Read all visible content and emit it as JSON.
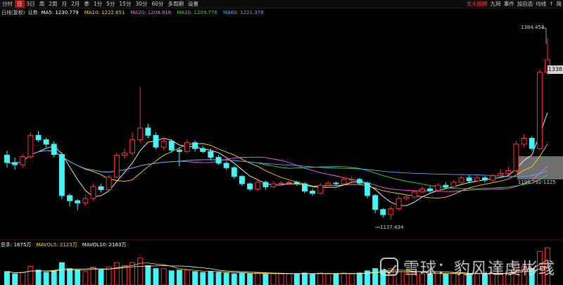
{
  "toolbar": {
    "tabs": [
      "分时",
      "日",
      "3日",
      "周",
      "2周",
      "月",
      "2月",
      "季",
      "1分",
      "5分",
      "15分",
      "30分",
      "60分",
      "多周期",
      "设置"
    ],
    "active_tab": "日",
    "tools": [
      "龙头回顾",
      "九转",
      "事件",
      "加自选",
      "均线",
      "↑",
      "简"
    ]
  },
  "ma_legend": {
    "title": "日线(复权)",
    "sub": "证券",
    "items": [
      {
        "label": "MA5: 1230.779",
        "color": "#ffffff"
      },
      {
        "label": "MA10: 1222.651",
        "color": "#ffd700"
      },
      {
        "label": "MA20: 1209.916",
        "color": "#ff60ff"
      },
      {
        "label": "MA30: 1209.776",
        "color": "#33e033"
      },
      {
        "label": "MA60: 1221.378",
        "color": "#55aaff"
      }
    ]
  },
  "vol_legend": [
    {
      "label": "总手: 1675万",
      "color": "#ffffff"
    },
    {
      "label": "MAVOL5: 2123万",
      "color": "#ffd700"
    },
    {
      "label": "MAVOL10: 2163万",
      "color": "#ffffff"
    }
  ],
  "price_labels": {
    "high": "1384.458",
    "low": "1137.434",
    "range": "1198.792-1225",
    "right_axis": "1338"
  },
  "watermark": "雪球：豹风達虔彬彧",
  "colors": {
    "up": "#ff3030",
    "down": "#3ff7f7",
    "ma5": "#ffffff",
    "ma10": "#ffd700",
    "ma20": "#ff60ff",
    "ma30": "#33e033",
    "ma60": "#55aaff"
  },
  "chart_data": {
    "type": "candlestick",
    "axis": {
      "price_ymin": 1120,
      "price_ymax": 1400
    },
    "candles": [
      [
        1225,
        1215,
        1231,
        1208
      ],
      [
        1215,
        1212,
        1222,
        1205
      ],
      [
        1212,
        1223,
        1226,
        1208
      ],
      [
        1223,
        1252,
        1256,
        1220
      ],
      [
        1252,
        1246,
        1258,
        1243
      ],
      [
        1246,
        1240,
        1249,
        1236
      ],
      [
        1240,
        1226,
        1244,
        1222
      ],
      [
        1226,
        1170,
        1229,
        1165
      ],
      [
        1170,
        1163,
        1173,
        1155
      ],
      [
        1163,
        1160,
        1165,
        1150
      ],
      [
        1160,
        1166,
        1170,
        1156
      ],
      [
        1166,
        1182,
        1186,
        1163
      ],
      [
        1182,
        1178,
        1186,
        1174
      ],
      [
        1178,
        1195,
        1198,
        1175
      ],
      [
        1195,
        1225,
        1228,
        1194
      ],
      [
        1225,
        1228,
        1234,
        1220
      ],
      [
        1228,
        1246,
        1256,
        1224
      ],
      [
        1246,
        1262,
        1318,
        1242
      ],
      [
        1262,
        1252,
        1268,
        1248
      ],
      [
        1252,
        1236,
        1256,
        1233
      ],
      [
        1236,
        1244,
        1249,
        1232
      ],
      [
        1244,
        1232,
        1247,
        1228
      ],
      [
        1232,
        1230,
        1236,
        1210
      ],
      [
        1230,
        1242,
        1246,
        1228
      ],
      [
        1242,
        1234,
        1245,
        1230
      ],
      [
        1234,
        1230,
        1238,
        1228
      ],
      [
        1230,
        1222,
        1234,
        1218
      ],
      [
        1222,
        1214,
        1225,
        1212
      ],
      [
        1214,
        1208,
        1216,
        1205
      ],
      [
        1208,
        1196,
        1210,
        1193
      ],
      [
        1196,
        1186,
        1198,
        1183
      ],
      [
        1186,
        1179,
        1188,
        1176
      ],
      [
        1179,
        1188,
        1193,
        1176
      ],
      [
        1188,
        1182,
        1190,
        1178
      ],
      [
        1182,
        1186,
        1189,
        1180
      ],
      [
        1186,
        1187,
        1190,
        1183
      ],
      [
        1187,
        1188,
        1190,
        1184
      ],
      [
        1188,
        1186,
        1190,
        1183
      ],
      [
        1186,
        1176,
        1188,
        1173
      ],
      [
        1176,
        1173,
        1179,
        1170
      ],
      [
        1173,
        1184,
        1187,
        1172
      ],
      [
        1184,
        1187,
        1189,
        1183
      ],
      [
        1187,
        1186,
        1189,
        1183
      ],
      [
        1186,
        1192,
        1195,
        1186
      ],
      [
        1192,
        1192,
        1196,
        1189
      ],
      [
        1192,
        1187,
        1194,
        1184
      ],
      [
        1187,
        1170,
        1189,
        1166
      ],
      [
        1170,
        1151,
        1172,
        1146
      ],
      [
        1151,
        1144,
        1153,
        1140
      ],
      [
        1144,
        1152,
        1155,
        1137
      ],
      [
        1152,
        1166,
        1169,
        1150
      ],
      [
        1166,
        1168,
        1171,
        1163
      ],
      [
        1168,
        1175,
        1177,
        1166
      ],
      [
        1175,
        1179,
        1183,
        1173
      ],
      [
        1179,
        1177,
        1183,
        1174
      ],
      [
        1177,
        1184,
        1187,
        1175
      ],
      [
        1184,
        1182,
        1188,
        1180
      ],
      [
        1182,
        1188,
        1191,
        1180
      ],
      [
        1188,
        1194,
        1197,
        1186
      ],
      [
        1194,
        1190,
        1198,
        1188
      ],
      [
        1190,
        1194,
        1197,
        1188
      ],
      [
        1194,
        1191,
        1197,
        1188
      ],
      [
        1191,
        1197,
        1200,
        1189
      ],
      [
        1197,
        1200,
        1206,
        1195
      ],
      [
        1200,
        1204,
        1209,
        1198
      ],
      [
        1204,
        1240,
        1245,
        1202
      ],
      [
        1240,
        1248,
        1254,
        1236
      ],
      [
        1248,
        1234,
        1251,
        1231
      ],
      [
        1234,
        1338,
        1342,
        1232
      ],
      [
        1338,
        1355,
        1384,
        1335
      ]
    ],
    "volumes": [
      18,
      15,
      17,
      25,
      20,
      17,
      19,
      30,
      22,
      20,
      18,
      24,
      20,
      24,
      30,
      26,
      30,
      36,
      26,
      22,
      22,
      19,
      20,
      20,
      18,
      17,
      18,
      17,
      16,
      15,
      16,
      15,
      16,
      15,
      15,
      15,
      15,
      15,
      16,
      15,
      16,
      15,
      15,
      16,
      15,
      16,
      19,
      22,
      20,
      22,
      18,
      16,
      16,
      15,
      15,
      16,
      15,
      16,
      16,
      15,
      15,
      15,
      16,
      16,
      17,
      28,
      25,
      22,
      45,
      50
    ]
  }
}
